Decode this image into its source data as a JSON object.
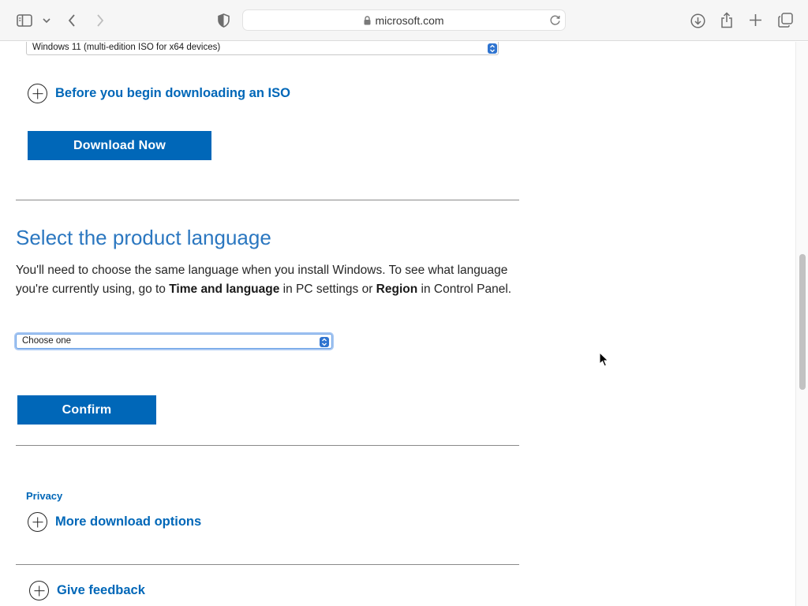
{
  "browser": {
    "address": "microsoft.com"
  },
  "iso_section": {
    "edition_selected": "Windows 11 (multi-edition ISO for x64 devices)",
    "before_begin_label": "Before you begin downloading an ISO",
    "download_button_label": "Download Now"
  },
  "language_section": {
    "title": "Select the product language",
    "desc_part1": "You'll need to choose the same language when you install Windows. To see what language you're currently using, go to ",
    "desc_bold1": "Time and language",
    "desc_part2": " in PC settings or ",
    "desc_bold2": "Region",
    "desc_part3": " in Control Panel.",
    "language_selected": "Choose one",
    "confirm_button_label": "Confirm"
  },
  "footer_section": {
    "privacy_label": "Privacy",
    "more_options_label": "More download options",
    "feedback_label": "Give feedback"
  },
  "colors": {
    "accent": "#0067b8",
    "heading_blue": "#2b77c0"
  }
}
